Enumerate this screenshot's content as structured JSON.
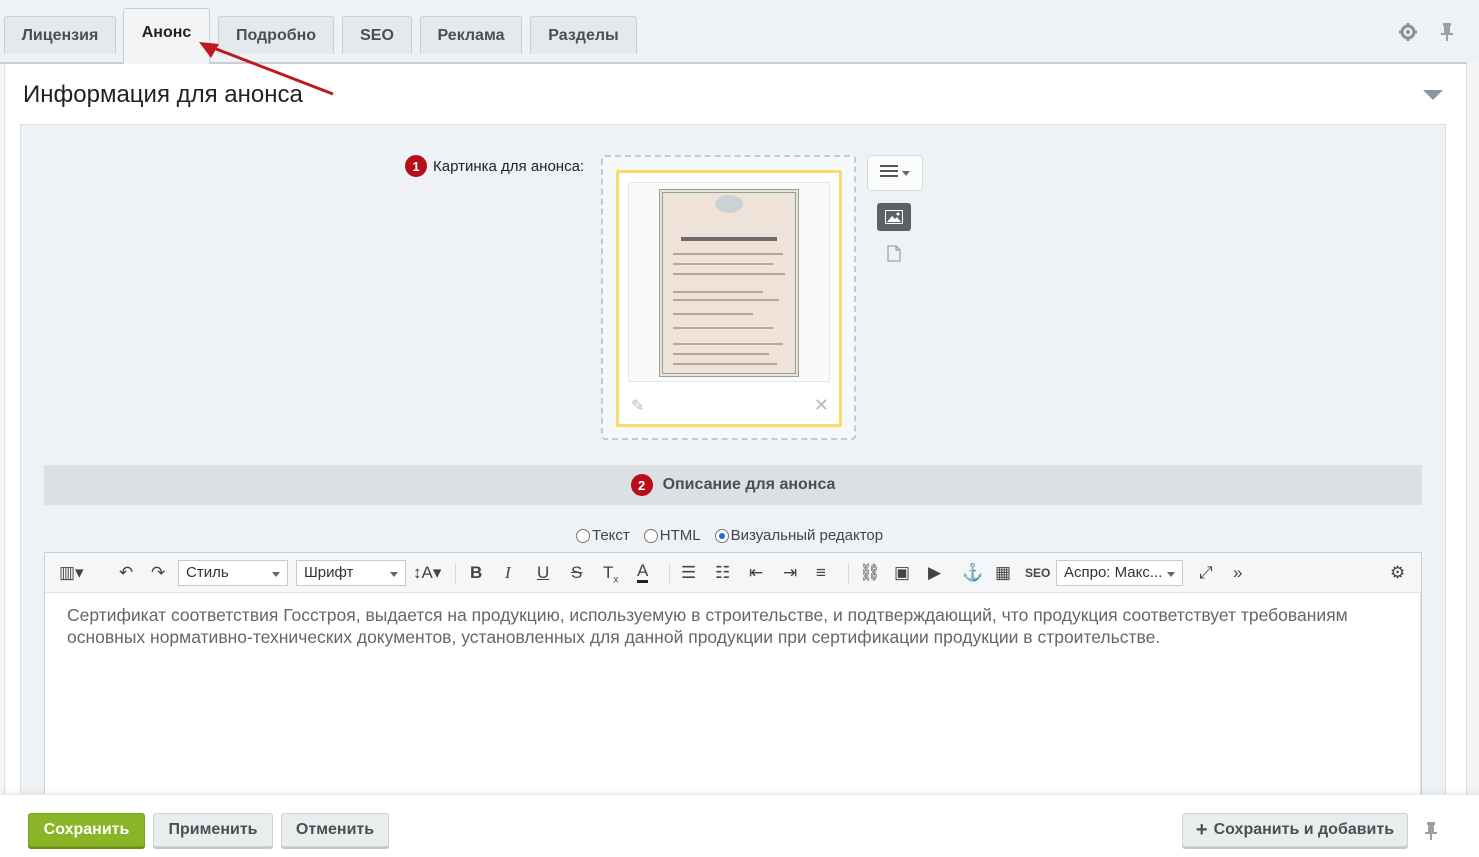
{
  "tabs": [
    {
      "label": "Лицензия",
      "active": false
    },
    {
      "label": "Анонс",
      "active": true
    },
    {
      "label": "Подробно",
      "active": false
    },
    {
      "label": "SEO",
      "active": false
    },
    {
      "label": "Реклама",
      "active": false
    },
    {
      "label": "Разделы",
      "active": false
    }
  ],
  "section": {
    "title": "Информация для анонса"
  },
  "picture": {
    "badge": "1",
    "label": "Картинка для анонса:"
  },
  "description": {
    "badge": "2",
    "title": "Описание для анонса"
  },
  "mode": {
    "options": [
      "Текст",
      "HTML",
      "Визуальный редактор"
    ],
    "selected": "Визуальный редактор"
  },
  "toolbar": {
    "style_select": "Стиль",
    "font_select": "Шрифт",
    "seo_label": "SEO",
    "snippet_select": "Аспро: Макс..."
  },
  "editor": {
    "text": "Сертификат соответствия Госстроя, выдается на продукцию, используемую в строительстве, и подтверждающий, что продукция соответствует требованиям основных нормативно-технических документов, установленных для данной продукции при сертификации продукции в строительстве."
  },
  "footer": {
    "save": "Сохранить",
    "apply": "Применить",
    "cancel": "Отменить",
    "save_add": "Сохранить и добавить"
  },
  "colors": {
    "accent_red": "#b70e1a",
    "save_green": "#8ab526",
    "thumb_border": "#f6dc6b"
  },
  "icons": [
    "gear-icon",
    "pin-icon",
    "collapse-arrow-icon",
    "hamburger-menu-icon",
    "image-icon",
    "file-icon",
    "pencil-icon",
    "close-icon",
    "plus-icon"
  ]
}
